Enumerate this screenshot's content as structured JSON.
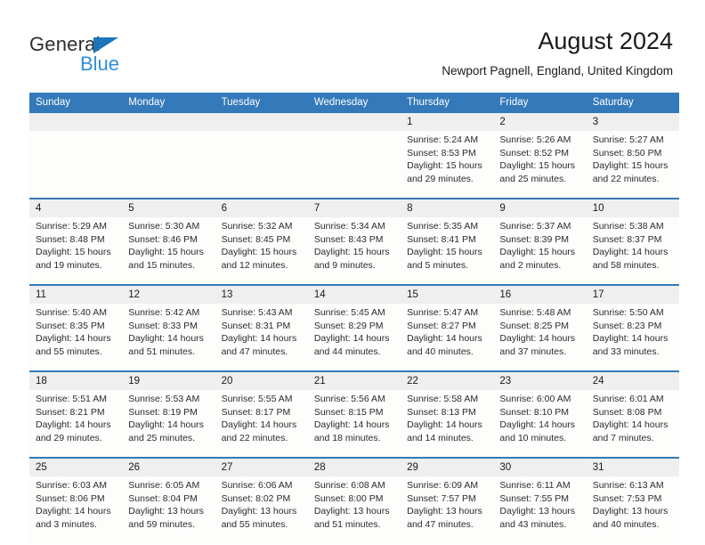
{
  "brand": {
    "name_dark": "General",
    "name_blue": "Blue",
    "accent_color": "#1b75bb",
    "accent_color_light": "#2f8fd6"
  },
  "header": {
    "title": "August 2024",
    "subtitle": "Newport Pagnell, England, United Kingdom",
    "header_bg": "#3479b9",
    "daynum_bg": "#efefef"
  },
  "weekday_headers": [
    "Sunday",
    "Monday",
    "Tuesday",
    "Wednesday",
    "Thursday",
    "Friday",
    "Saturday"
  ],
  "weeks": [
    {
      "days": [
        {
          "num": "",
          "sunrise": "",
          "sunset": "",
          "daylight_1": "",
          "daylight_2": ""
        },
        {
          "num": "",
          "sunrise": "",
          "sunset": "",
          "daylight_1": "",
          "daylight_2": ""
        },
        {
          "num": "",
          "sunrise": "",
          "sunset": "",
          "daylight_1": "",
          "daylight_2": ""
        },
        {
          "num": "",
          "sunrise": "",
          "sunset": "",
          "daylight_1": "",
          "daylight_2": ""
        },
        {
          "num": "1",
          "sunrise": "Sunrise: 5:24 AM",
          "sunset": "Sunset: 8:53 PM",
          "daylight_1": "Daylight: 15 hours",
          "daylight_2": "and 29 minutes."
        },
        {
          "num": "2",
          "sunrise": "Sunrise: 5:26 AM",
          "sunset": "Sunset: 8:52 PM",
          "daylight_1": "Daylight: 15 hours",
          "daylight_2": "and 25 minutes."
        },
        {
          "num": "3",
          "sunrise": "Sunrise: 5:27 AM",
          "sunset": "Sunset: 8:50 PM",
          "daylight_1": "Daylight: 15 hours",
          "daylight_2": "and 22 minutes."
        }
      ]
    },
    {
      "days": [
        {
          "num": "4",
          "sunrise": "Sunrise: 5:29 AM",
          "sunset": "Sunset: 8:48 PM",
          "daylight_1": "Daylight: 15 hours",
          "daylight_2": "and 19 minutes."
        },
        {
          "num": "5",
          "sunrise": "Sunrise: 5:30 AM",
          "sunset": "Sunset: 8:46 PM",
          "daylight_1": "Daylight: 15 hours",
          "daylight_2": "and 15 minutes."
        },
        {
          "num": "6",
          "sunrise": "Sunrise: 5:32 AM",
          "sunset": "Sunset: 8:45 PM",
          "daylight_1": "Daylight: 15 hours",
          "daylight_2": "and 12 minutes."
        },
        {
          "num": "7",
          "sunrise": "Sunrise: 5:34 AM",
          "sunset": "Sunset: 8:43 PM",
          "daylight_1": "Daylight: 15 hours",
          "daylight_2": "and 9 minutes."
        },
        {
          "num": "8",
          "sunrise": "Sunrise: 5:35 AM",
          "sunset": "Sunset: 8:41 PM",
          "daylight_1": "Daylight: 15 hours",
          "daylight_2": "and 5 minutes."
        },
        {
          "num": "9",
          "sunrise": "Sunrise: 5:37 AM",
          "sunset": "Sunset: 8:39 PM",
          "daylight_1": "Daylight: 15 hours",
          "daylight_2": "and 2 minutes."
        },
        {
          "num": "10",
          "sunrise": "Sunrise: 5:38 AM",
          "sunset": "Sunset: 8:37 PM",
          "daylight_1": "Daylight: 14 hours",
          "daylight_2": "and 58 minutes."
        }
      ]
    },
    {
      "days": [
        {
          "num": "11",
          "sunrise": "Sunrise: 5:40 AM",
          "sunset": "Sunset: 8:35 PM",
          "daylight_1": "Daylight: 14 hours",
          "daylight_2": "and 55 minutes."
        },
        {
          "num": "12",
          "sunrise": "Sunrise: 5:42 AM",
          "sunset": "Sunset: 8:33 PM",
          "daylight_1": "Daylight: 14 hours",
          "daylight_2": "and 51 minutes."
        },
        {
          "num": "13",
          "sunrise": "Sunrise: 5:43 AM",
          "sunset": "Sunset: 8:31 PM",
          "daylight_1": "Daylight: 14 hours",
          "daylight_2": "and 47 minutes."
        },
        {
          "num": "14",
          "sunrise": "Sunrise: 5:45 AM",
          "sunset": "Sunset: 8:29 PM",
          "daylight_1": "Daylight: 14 hours",
          "daylight_2": "and 44 minutes."
        },
        {
          "num": "15",
          "sunrise": "Sunrise: 5:47 AM",
          "sunset": "Sunset: 8:27 PM",
          "daylight_1": "Daylight: 14 hours",
          "daylight_2": "and 40 minutes."
        },
        {
          "num": "16",
          "sunrise": "Sunrise: 5:48 AM",
          "sunset": "Sunset: 8:25 PM",
          "daylight_1": "Daylight: 14 hours",
          "daylight_2": "and 37 minutes."
        },
        {
          "num": "17",
          "sunrise": "Sunrise: 5:50 AM",
          "sunset": "Sunset: 8:23 PM",
          "daylight_1": "Daylight: 14 hours",
          "daylight_2": "and 33 minutes."
        }
      ]
    },
    {
      "days": [
        {
          "num": "18",
          "sunrise": "Sunrise: 5:51 AM",
          "sunset": "Sunset: 8:21 PM",
          "daylight_1": "Daylight: 14 hours",
          "daylight_2": "and 29 minutes."
        },
        {
          "num": "19",
          "sunrise": "Sunrise: 5:53 AM",
          "sunset": "Sunset: 8:19 PM",
          "daylight_1": "Daylight: 14 hours",
          "daylight_2": "and 25 minutes."
        },
        {
          "num": "20",
          "sunrise": "Sunrise: 5:55 AM",
          "sunset": "Sunset: 8:17 PM",
          "daylight_1": "Daylight: 14 hours",
          "daylight_2": "and 22 minutes."
        },
        {
          "num": "21",
          "sunrise": "Sunrise: 5:56 AM",
          "sunset": "Sunset: 8:15 PM",
          "daylight_1": "Daylight: 14 hours",
          "daylight_2": "and 18 minutes."
        },
        {
          "num": "22",
          "sunrise": "Sunrise: 5:58 AM",
          "sunset": "Sunset: 8:13 PM",
          "daylight_1": "Daylight: 14 hours",
          "daylight_2": "and 14 minutes."
        },
        {
          "num": "23",
          "sunrise": "Sunrise: 6:00 AM",
          "sunset": "Sunset: 8:10 PM",
          "daylight_1": "Daylight: 14 hours",
          "daylight_2": "and 10 minutes."
        },
        {
          "num": "24",
          "sunrise": "Sunrise: 6:01 AM",
          "sunset": "Sunset: 8:08 PM",
          "daylight_1": "Daylight: 14 hours",
          "daylight_2": "and 7 minutes."
        }
      ]
    },
    {
      "days": [
        {
          "num": "25",
          "sunrise": "Sunrise: 6:03 AM",
          "sunset": "Sunset: 8:06 PM",
          "daylight_1": "Daylight: 14 hours",
          "daylight_2": "and 3 minutes."
        },
        {
          "num": "26",
          "sunrise": "Sunrise: 6:05 AM",
          "sunset": "Sunset: 8:04 PM",
          "daylight_1": "Daylight: 13 hours",
          "daylight_2": "and 59 minutes."
        },
        {
          "num": "27",
          "sunrise": "Sunrise: 6:06 AM",
          "sunset": "Sunset: 8:02 PM",
          "daylight_1": "Daylight: 13 hours",
          "daylight_2": "and 55 minutes."
        },
        {
          "num": "28",
          "sunrise": "Sunrise: 6:08 AM",
          "sunset": "Sunset: 8:00 PM",
          "daylight_1": "Daylight: 13 hours",
          "daylight_2": "and 51 minutes."
        },
        {
          "num": "29",
          "sunrise": "Sunrise: 6:09 AM",
          "sunset": "Sunset: 7:57 PM",
          "daylight_1": "Daylight: 13 hours",
          "daylight_2": "and 47 minutes."
        },
        {
          "num": "30",
          "sunrise": "Sunrise: 6:11 AM",
          "sunset": "Sunset: 7:55 PM",
          "daylight_1": "Daylight: 13 hours",
          "daylight_2": "and 43 minutes."
        },
        {
          "num": "31",
          "sunrise": "Sunrise: 6:13 AM",
          "sunset": "Sunset: 7:53 PM",
          "daylight_1": "Daylight: 13 hours",
          "daylight_2": "and 40 minutes."
        }
      ]
    }
  ]
}
